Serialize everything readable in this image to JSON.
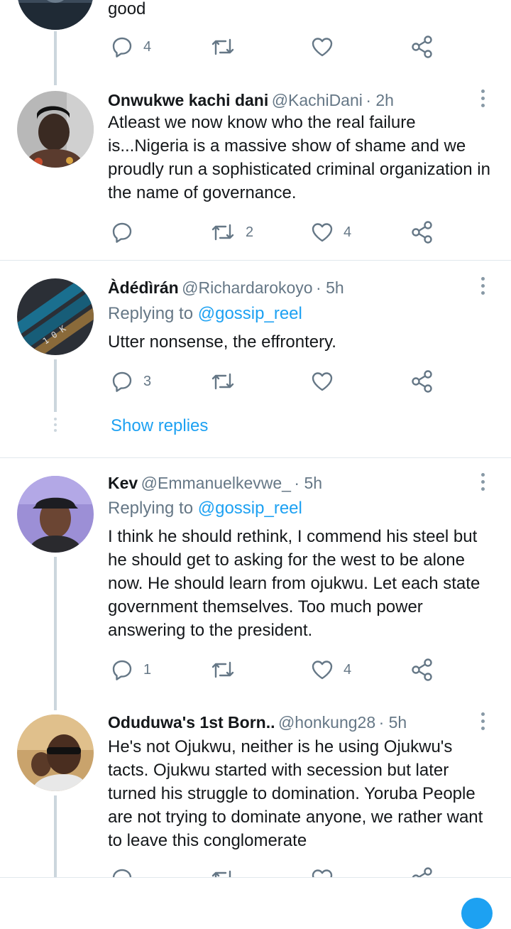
{
  "top_tweet": {
    "text_tail": "good",
    "reply_count": "4",
    "retweet_count": "",
    "like_count": ""
  },
  "tweets": [
    {
      "name": "Onwukwe kachi dani",
      "handle": "@KachiDani",
      "time": "· 2h",
      "replying_label": "",
      "replying_to": "",
      "text": "Atleast we now know who the real failure is...Nigeria is a massive show of shame and we proudly run a sophisticated criminal organization in the name of governance.",
      "reply_count": "",
      "retweet_count": "2",
      "like_count": "4"
    },
    {
      "name": "Àdédìrán",
      "handle": "@Richardarokoyo",
      "time": "· 5h",
      "replying_label": "Replying to",
      "replying_to": "@gossip_reel",
      "text": "Utter nonsense, the effrontery.",
      "reply_count": "3",
      "retweet_count": "",
      "like_count": "",
      "show_replies": "Show replies"
    },
    {
      "name": "Kev",
      "handle": "@Emmanuelkevwe_",
      "time": "· 5h",
      "replying_label": "Replying to",
      "replying_to": "@gossip_reel",
      "text": "I think he should rethink, I commend his steel but he should get to asking for the west to be alone now. He should learn from ojukwu. Let each state government themselves. Too much power answering to the president.",
      "reply_count": "1",
      "retweet_count": "",
      "like_count": "4"
    },
    {
      "name": "Oduduwa's 1st Born..",
      "handle": "@honkung28",
      "time": "· 5h",
      "replying_label": "",
      "replying_to": "",
      "text": "He's not Ojukwu, neither is he using Ojukwu's tacts. Ojukwu started with secession but later turned his struggle to domination. Yoruba People are not trying to dominate anyone, we rather want to leave this conglomerate",
      "reply_count": "",
      "retweet_count": "",
      "like_count": ""
    }
  ],
  "colors": {
    "accent": "#1da1f2",
    "icon": "#657786",
    "thread_line": "#ccd6dd"
  },
  "icons": [
    "reply-icon",
    "retweet-icon",
    "like-icon",
    "share-icon",
    "more-icon"
  ]
}
